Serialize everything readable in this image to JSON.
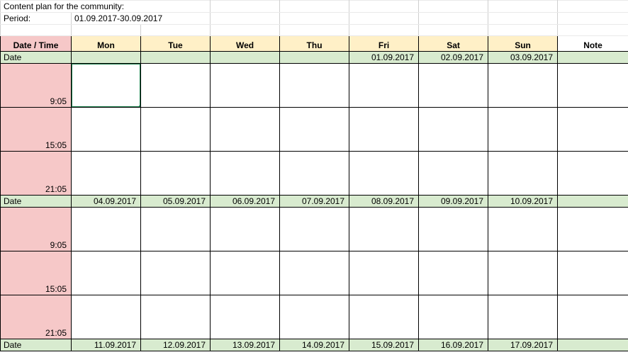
{
  "info": {
    "title": "Content plan for the community:",
    "period_label": "Period:",
    "period_value": "01.09.2017-30.09.2017"
  },
  "header": {
    "datetime": "Date / Time",
    "days": [
      "Mon",
      "Tue",
      "Wed",
      "Thu",
      "Fri",
      "Sat",
      "Sun"
    ],
    "note": "Note"
  },
  "date_label": "Date",
  "times": [
    "9:05",
    "15:05",
    "21:05"
  ],
  "weeks": [
    {
      "dates": [
        "",
        "",
        "",
        "",
        "01.09.2017",
        "02.09.2017",
        "03.09.2017"
      ]
    },
    {
      "dates": [
        "04.09.2017",
        "05.09.2017",
        "06.09.2017",
        "07.09.2017",
        "08.09.2017",
        "09.09.2017",
        "10.09.2017"
      ]
    },
    {
      "dates": [
        "11.09.2017",
        "12.09.2017",
        "13.09.2017",
        "14.09.2017",
        "15.09.2017",
        "16.09.2017",
        "17.09.2017"
      ]
    }
  ]
}
